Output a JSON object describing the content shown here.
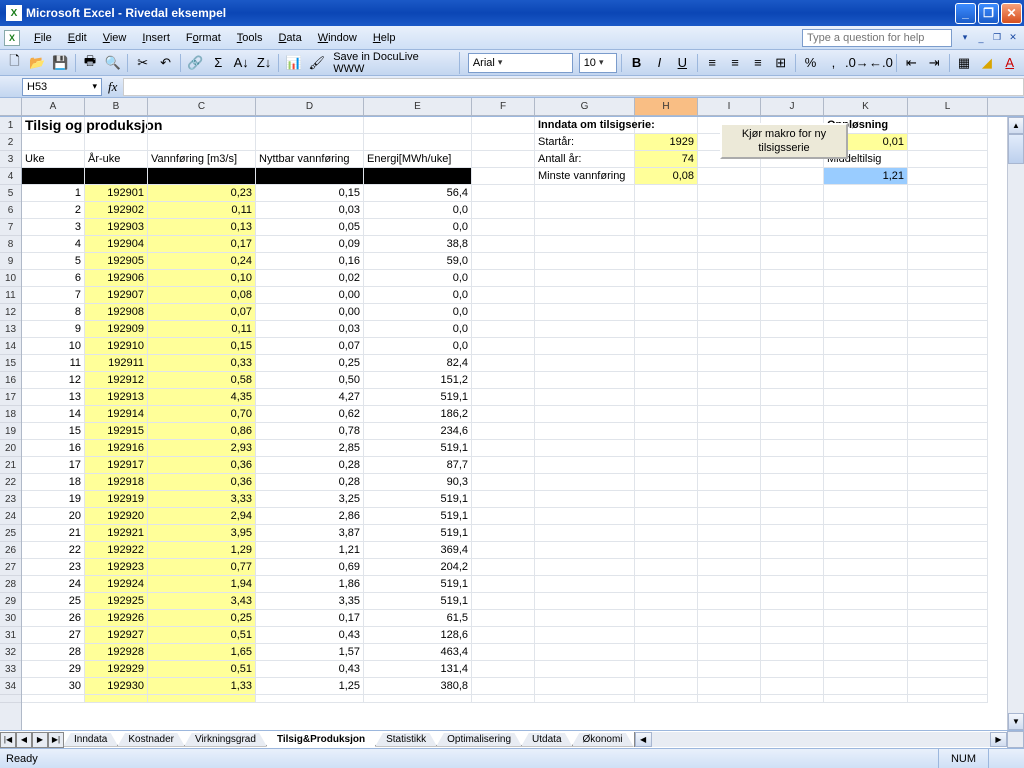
{
  "window": {
    "title": "Microsoft Excel - Rivedal eksempel"
  },
  "menu": {
    "file": "File",
    "edit": "Edit",
    "view": "View",
    "insert": "Insert",
    "format": "Format",
    "tools": "Tools",
    "data": "Data",
    "window": "Window",
    "help": "Help",
    "helpbox": "Type a question for help"
  },
  "toolbar": {
    "save_doculive": "Save in DocuLive WWW",
    "font": "Arial",
    "size": "10"
  },
  "namebox": "H53",
  "columns": [
    {
      "label": "A",
      "w": 63
    },
    {
      "label": "B",
      "w": 63
    },
    {
      "label": "C",
      "w": 108
    },
    {
      "label": "D",
      "w": 108
    },
    {
      "label": "E",
      "w": 108
    },
    {
      "label": "F",
      "w": 63
    },
    {
      "label": "G",
      "w": 100
    },
    {
      "label": "H",
      "w": 63
    },
    {
      "label": "I",
      "w": 63
    },
    {
      "label": "J",
      "w": 63
    },
    {
      "label": "K",
      "w": 84
    },
    {
      "label": "L",
      "w": 80
    }
  ],
  "title_cell": "Tilsig og produksjon",
  "headers_row3": {
    "A": "Uke",
    "B": "År-uke",
    "C": "Vannføring [m3/s]",
    "D": "Nyttbar vannføring",
    "E": "Energi[MWh/uke]"
  },
  "inndata": {
    "header": "Inndata om tilsigserie:",
    "startaar_lbl": "Startår:",
    "startaar_val": "1929",
    "antall_lbl": "Antall år:",
    "antall_val": "74",
    "minste_lbl": "Minste vannføring",
    "minste_val": "0,08"
  },
  "opplosning": {
    "header": "Oppløsning",
    "val": "0,01",
    "middel_lbl": "Middeltilsig",
    "middel_val": "1,21"
  },
  "macro_btn": "Kjør makro for ny tilsigsserie",
  "data_rows": [
    {
      "r": 5,
      "a": "1",
      "b": "192901",
      "c": "0,23",
      "d": "0,15",
      "e": "56,4"
    },
    {
      "r": 6,
      "a": "2",
      "b": "192902",
      "c": "0,11",
      "d": "0,03",
      "e": "0,0"
    },
    {
      "r": 7,
      "a": "3",
      "b": "192903",
      "c": "0,13",
      "d": "0,05",
      "e": "0,0"
    },
    {
      "r": 8,
      "a": "4",
      "b": "192904",
      "c": "0,17",
      "d": "0,09",
      "e": "38,8"
    },
    {
      "r": 9,
      "a": "5",
      "b": "192905",
      "c": "0,24",
      "d": "0,16",
      "e": "59,0"
    },
    {
      "r": 10,
      "a": "6",
      "b": "192906",
      "c": "0,10",
      "d": "0,02",
      "e": "0,0"
    },
    {
      "r": 11,
      "a": "7",
      "b": "192907",
      "c": "0,08",
      "d": "0,00",
      "e": "0,0"
    },
    {
      "r": 12,
      "a": "8",
      "b": "192908",
      "c": "0,07",
      "d": "0,00",
      "e": "0,0"
    },
    {
      "r": 13,
      "a": "9",
      "b": "192909",
      "c": "0,11",
      "d": "0,03",
      "e": "0,0"
    },
    {
      "r": 14,
      "a": "10",
      "b": "192910",
      "c": "0,15",
      "d": "0,07",
      "e": "0,0"
    },
    {
      "r": 15,
      "a": "11",
      "b": "192911",
      "c": "0,33",
      "d": "0,25",
      "e": "82,4"
    },
    {
      "r": 16,
      "a": "12",
      "b": "192912",
      "c": "0,58",
      "d": "0,50",
      "e": "151,2"
    },
    {
      "r": 17,
      "a": "13",
      "b": "192913",
      "c": "4,35",
      "d": "4,27",
      "e": "519,1"
    },
    {
      "r": 18,
      "a": "14",
      "b": "192914",
      "c": "0,70",
      "d": "0,62",
      "e": "186,2"
    },
    {
      "r": 19,
      "a": "15",
      "b": "192915",
      "c": "0,86",
      "d": "0,78",
      "e": "234,6"
    },
    {
      "r": 20,
      "a": "16",
      "b": "192916",
      "c": "2,93",
      "d": "2,85",
      "e": "519,1"
    },
    {
      "r": 21,
      "a": "17",
      "b": "192917",
      "c": "0,36",
      "d": "0,28",
      "e": "87,7"
    },
    {
      "r": 22,
      "a": "18",
      "b": "192918",
      "c": "0,36",
      "d": "0,28",
      "e": "90,3"
    },
    {
      "r": 23,
      "a": "19",
      "b": "192919",
      "c": "3,33",
      "d": "3,25",
      "e": "519,1"
    },
    {
      "r": 24,
      "a": "20",
      "b": "192920",
      "c": "2,94",
      "d": "2,86",
      "e": "519,1"
    },
    {
      "r": 25,
      "a": "21",
      "b": "192921",
      "c": "3,95",
      "d": "3,87",
      "e": "519,1"
    },
    {
      "r": 26,
      "a": "22",
      "b": "192922",
      "c": "1,29",
      "d": "1,21",
      "e": "369,4"
    },
    {
      "r": 27,
      "a": "23",
      "b": "192923",
      "c": "0,77",
      "d": "0,69",
      "e": "204,2"
    },
    {
      "r": 28,
      "a": "24",
      "b": "192924",
      "c": "1,94",
      "d": "1,86",
      "e": "519,1"
    },
    {
      "r": 29,
      "a": "25",
      "b": "192925",
      "c": "3,43",
      "d": "3,35",
      "e": "519,1"
    },
    {
      "r": 30,
      "a": "26",
      "b": "192926",
      "c": "0,25",
      "d": "0,17",
      "e": "61,5"
    },
    {
      "r": 31,
      "a": "27",
      "b": "192927",
      "c": "0,51",
      "d": "0,43",
      "e": "128,6"
    },
    {
      "r": 32,
      "a": "28",
      "b": "192928",
      "c": "1,65",
      "d": "1,57",
      "e": "463,4"
    },
    {
      "r": 33,
      "a": "29",
      "b": "192929",
      "c": "0,51",
      "d": "0,43",
      "e": "131,4"
    },
    {
      "r": 34,
      "a": "30",
      "b": "192930",
      "c": "1,33",
      "d": "1,25",
      "e": "380,8"
    }
  ],
  "tabs": [
    {
      "label": "Inndata",
      "active": false
    },
    {
      "label": "Kostnader",
      "active": false
    },
    {
      "label": "Virkningsgrad",
      "active": false
    },
    {
      "label": "Tilsig&Produksjon",
      "active": true
    },
    {
      "label": "Statistikk",
      "active": false
    },
    {
      "label": "Optimalisering",
      "active": false
    },
    {
      "label": "Utdata",
      "active": false
    },
    {
      "label": "Økonomi",
      "active": false
    }
  ],
  "status": {
    "ready": "Ready",
    "num": "NUM"
  }
}
